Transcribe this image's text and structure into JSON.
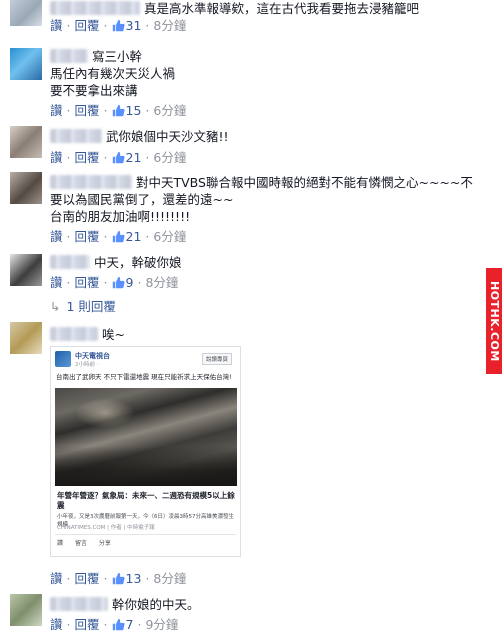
{
  "comments": [
    {
      "text": "真是高水準報導欸，這在古代我看要拖去浸豬籠吧",
      "likes": "31",
      "time": "8分鐘"
    },
    {
      "text": "寫三小幹",
      "extra1": "馬任內有幾次天災人禍",
      "extra2": "要不要拿出來講",
      "likes": "15",
      "time": "6分鐘"
    },
    {
      "text": "武你娘個中天沙文豬!!",
      "likes": "21",
      "time": "6分鐘"
    },
    {
      "text": "對中天TVBS聯合報中國時報的絕對不能有憐憫之心~~~~不",
      "extra1": "要以為國民黨倒了，還差的遠~~",
      "extra2": "台南的朋友加油啊!!!!!!!!",
      "likes": "21",
      "time": "6分鐘"
    },
    {
      "text": "中天，幹破你娘",
      "likes": "9",
      "time": "8分鐘",
      "replies": "1 則回覆"
    },
    {
      "text": "唉~",
      "likes": "13",
      "time": "8分鐘"
    },
    {
      "text": "幹你娘的中天。",
      "likes": "7",
      "time": "9分鐘"
    }
  ],
  "actions": {
    "like": "讚",
    "reply": "回覆"
  },
  "card": {
    "page_name": "中天電視台",
    "page_time": "2小時前 · ",
    "follow": "說讚專頁",
    "text": "台南出了武卵天 不只下雷還地震 現在只能祈求上天保佑台灣!",
    "link_title": "年營年營逐？氣象局：未來一、二週恐有規模5以上餘震",
    "link_desc": "小年夜，又是3次農曆前報第一天，今（6日）凌晨3時57分高雄美濃發生規模",
    "link_source": "CHINATIMES.COM | 作者 | 中時電子報",
    "like": "讚",
    "comment": "留言",
    "share": "分享"
  },
  "watermark": "HOTHK.COM",
  "colors": {
    "link": "#365899",
    "watermark": "#e8212b",
    "meta": "#90949c"
  }
}
